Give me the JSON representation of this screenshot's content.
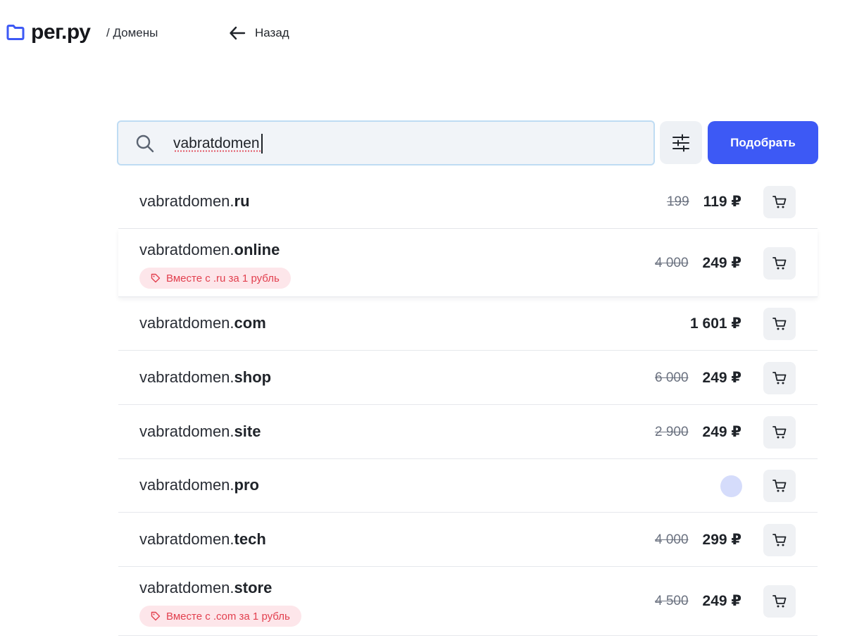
{
  "brand": {
    "name": "рег.ру",
    "color": "#3d59f5"
  },
  "breadcrumb": "/ Домены",
  "back": {
    "label": "Назад",
    "icon": "arrow-left-icon"
  },
  "search": {
    "value": "vabratdomen",
    "button_label": "Подобрать",
    "icon": "search-icon",
    "filter_icon": "sliders-icon"
  },
  "results": [
    {
      "base": "vabratdomen.",
      "tld": "ru",
      "old_price": "199",
      "price": "119 ₽",
      "promo": ""
    },
    {
      "base": "vabratdomen.",
      "tld": "online",
      "old_price": "4 000",
      "price": "249 ₽",
      "promo": "Вместе с .ru за 1 рубль"
    },
    {
      "base": "vabratdomen.",
      "tld": "com",
      "old_price": "",
      "price": "1 601 ₽",
      "promo": ""
    },
    {
      "base": "vabratdomen.",
      "tld": "shop",
      "old_price": "6 000",
      "price": "249 ₽",
      "promo": ""
    },
    {
      "base": "vabratdomen.",
      "tld": "site",
      "old_price": "2 900",
      "price": "249 ₽",
      "promo": ""
    },
    {
      "base": "vabratdomen.",
      "tld": "pro",
      "old_price": "",
      "price": "",
      "promo": "",
      "loading": true
    },
    {
      "base": "vabratdomen.",
      "tld": "tech",
      "old_price": "4 000",
      "price": "299 ₽",
      "promo": ""
    },
    {
      "base": "vabratdomen.",
      "tld": "store",
      "old_price": "4 500",
      "price": "249 ₽",
      "promo": "Вместе с .com за 1 рубль"
    }
  ],
  "cart_icon": "cart-icon",
  "promo_icon": "tag-icon"
}
